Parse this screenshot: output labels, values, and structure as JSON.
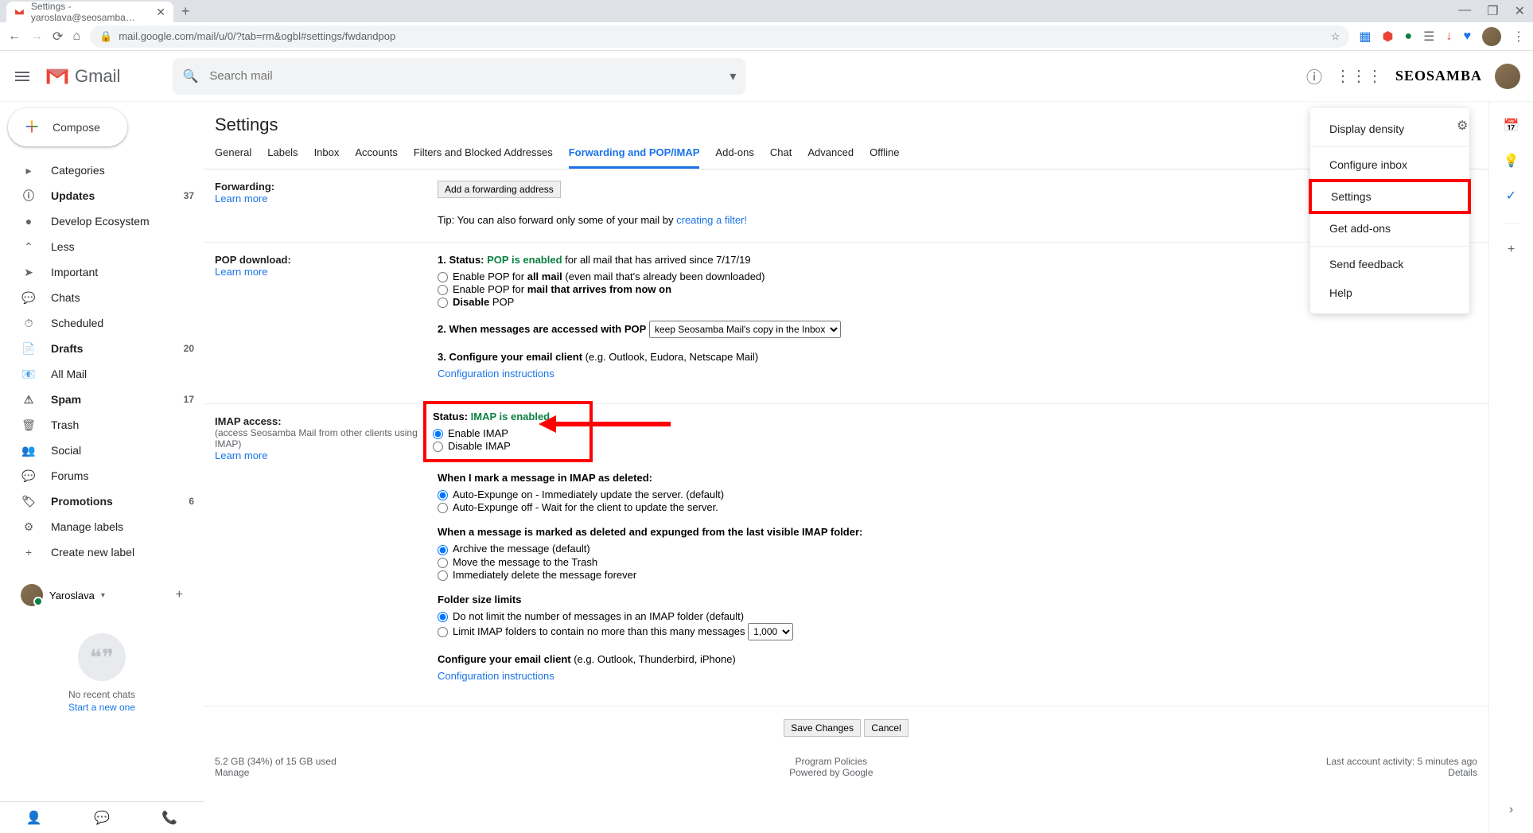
{
  "browser": {
    "tab_title": "Settings - yaroslava@seosamba…",
    "url": "mail.google.com/mail/u/0/?tab=rm&ogbl#settings/fwdandpop"
  },
  "header": {
    "logo_text": "Gmail",
    "search_placeholder": "Search mail",
    "brand": "SEOSAMBA"
  },
  "compose": "Compose",
  "sidebar": {
    "items": [
      {
        "label": "Categories",
        "icon": "▸"
      },
      {
        "label": "Updates",
        "icon": "ⓘ",
        "count": "37",
        "bold": true
      },
      {
        "label": "Develop Ecosystem",
        "icon": "●"
      },
      {
        "label": "Less",
        "icon": "⌃"
      },
      {
        "label": "Important",
        "icon": "➤"
      },
      {
        "label": "Chats",
        "icon": "💬"
      },
      {
        "label": "Scheduled",
        "icon": "⏱"
      },
      {
        "label": "Drafts",
        "icon": "📄",
        "count": "20",
        "bold": true
      },
      {
        "label": "All Mail",
        "icon": "📧"
      },
      {
        "label": "Spam",
        "icon": "⚠",
        "count": "17",
        "bold": true
      },
      {
        "label": "Trash",
        "icon": "🗑"
      },
      {
        "label": "Social",
        "icon": "👥",
        "indent": true
      },
      {
        "label": "Forums",
        "icon": "💬",
        "indent": true
      },
      {
        "label": "Promotions",
        "icon": "🏷",
        "count": "6",
        "bold": true,
        "indent": true
      },
      {
        "label": "Manage labels",
        "icon": "⚙"
      },
      {
        "label": "Create new label",
        "icon": "+"
      }
    ]
  },
  "hangouts": {
    "user": "Yaroslava",
    "no_chats": "No recent chats",
    "start": "Start a new one"
  },
  "settings": {
    "title": "Settings",
    "tabs": [
      "General",
      "Labels",
      "Inbox",
      "Accounts",
      "Filters and Blocked Addresses",
      "Forwarding and POP/IMAP",
      "Add-ons",
      "Chat",
      "Advanced",
      "Offline"
    ],
    "active_tab": 5,
    "forwarding": {
      "title": "Forwarding:",
      "learn": "Learn more",
      "add_btn": "Add a forwarding address",
      "tip": "Tip: You can also forward only some of your mail by ",
      "tip_link": "creating a filter!"
    },
    "pop": {
      "title": "POP download:",
      "learn": "Learn more",
      "status_prefix": "1. Status: ",
      "status_val": "POP is enabled",
      "status_suffix": " for all mail that has arrived since 7/17/19",
      "opt1_a": "Enable POP for ",
      "opt1_b": "all mail",
      "opt1_c": " (even mail that's already been downloaded)",
      "opt2_a": "Enable POP for ",
      "opt2_b": "mail that arrives from now on",
      "opt3_a": "Disable",
      "opt3_b": " POP",
      "q2": "2. When messages are accessed with POP",
      "q2_select": "keep Seosamba Mail's copy in the Inbox",
      "q3_a": "3. Configure your email client",
      "q3_b": " (e.g. Outlook, Eudora, Netscape Mail)",
      "q3_link": "Configuration instructions"
    },
    "imap": {
      "title": "IMAP access:",
      "sub": "(access Seosamba Mail from other clients using IMAP)",
      "learn": "Learn more",
      "status_prefix": "Status: ",
      "status_val": "IMAP is enabled",
      "opt1": "Enable IMAP",
      "opt2": "Disable IMAP",
      "del_title": "When I mark a message in IMAP as deleted:",
      "del_opt1": "Auto-Expunge on - Immediately update the server. (default)",
      "del_opt2": "Auto-Expunge off - Wait for the client to update the server.",
      "exp_title": "When a message is marked as deleted and expunged from the last visible IMAP folder:",
      "exp_opt1": "Archive the message (default)",
      "exp_opt2": "Move the message to the Trash",
      "exp_opt3": "Immediately delete the message forever",
      "size_title": "Folder size limits",
      "size_opt1": "Do not limit the number of messages in an IMAP folder (default)",
      "size_opt2": "Limit IMAP folders to contain no more than this many messages ",
      "size_select": "1,000",
      "conf_a": "Configure your email client",
      "conf_b": " (e.g. Outlook, Thunderbird, iPhone)",
      "conf_link": "Configuration instructions"
    },
    "save": "Save Changes",
    "cancel": "Cancel"
  },
  "footer": {
    "storage": "5.2 GB (34%) of 15 GB used",
    "manage": "Manage",
    "policies": "Program Policies",
    "powered": "Powered by Google",
    "activity": "Last account activity: 5 minutes ago",
    "details": "Details"
  },
  "menu": {
    "items": [
      "Display density",
      "Configure inbox",
      "Settings",
      "Get add-ons",
      "Send feedback",
      "Help"
    ]
  }
}
